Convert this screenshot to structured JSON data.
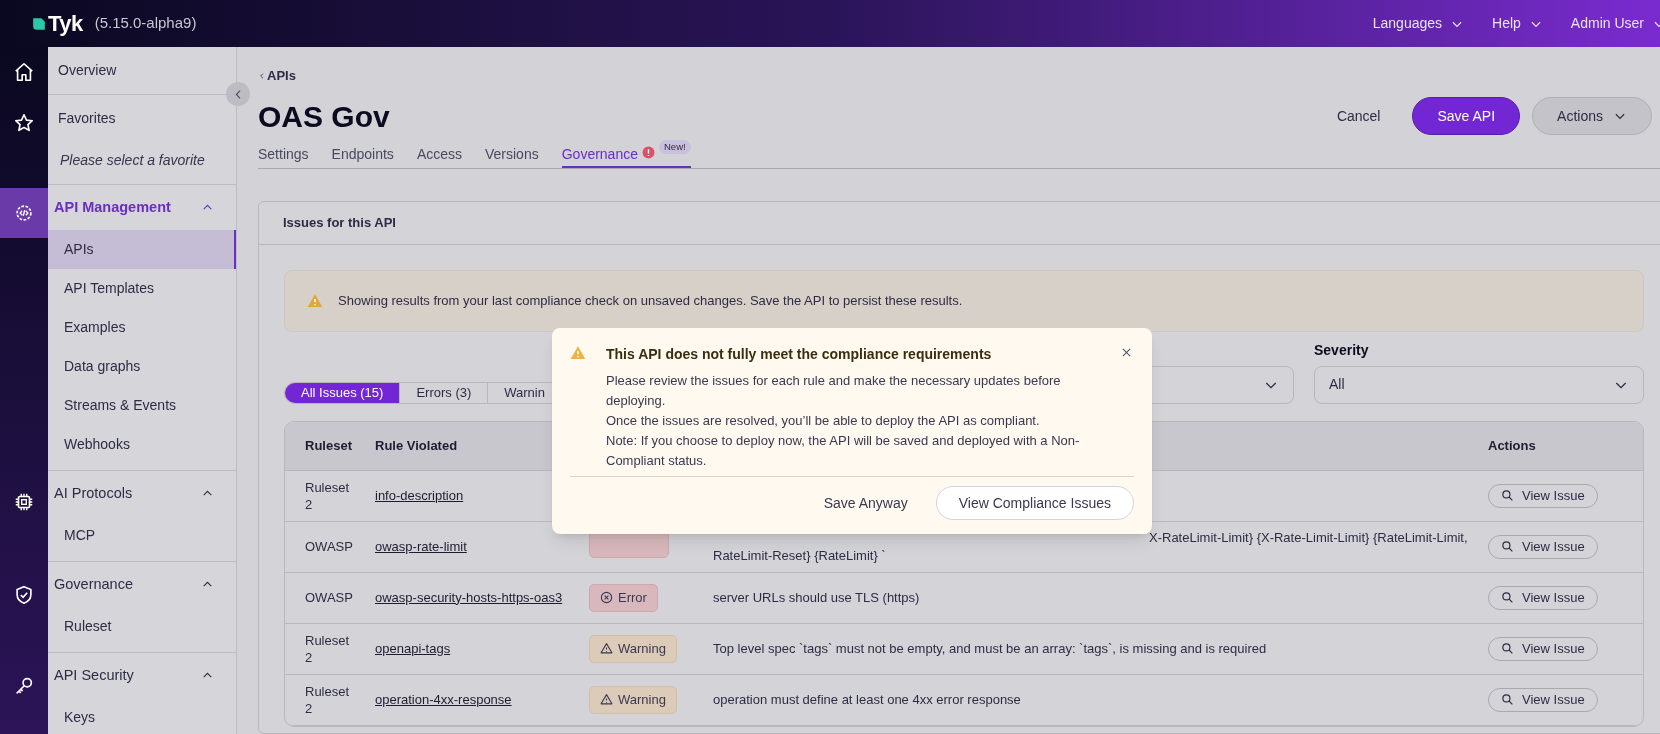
{
  "topbar": {
    "logo": "Tyk",
    "version": "(5.15.0-alpha9)",
    "menus": [
      "Languages",
      "Help",
      "Admin User"
    ]
  },
  "rail": [
    {
      "kind": "home",
      "selected": false
    },
    {
      "kind": "star",
      "selected": false
    },
    {
      "kind": "gear",
      "selected": true
    },
    {
      "kind": "chip",
      "selected": false
    },
    {
      "kind": "shield",
      "selected": false
    },
    {
      "kind": "key",
      "selected": false
    }
  ],
  "sidebar": [
    {
      "kind": "link",
      "label": "Overview"
    },
    {
      "kind": "link",
      "label": "Favorites",
      "note": "Please select a favorite"
    },
    {
      "kind": "group",
      "label": "API Management",
      "expanded": true,
      "selected": true,
      "children": [
        {
          "label": "APIs",
          "selected": true
        },
        {
          "label": "API Templates",
          "selected": false
        },
        {
          "label": "Examples",
          "selected": false
        },
        {
          "label": "Data graphs",
          "selected": false
        },
        {
          "label": "Streams & Events",
          "selected": false
        },
        {
          "label": "Webhooks",
          "selected": false
        }
      ]
    },
    {
      "kind": "group",
      "label": "AI Protocols",
      "expanded": true,
      "selected": false,
      "children": [
        {
          "label": "MCP",
          "selected": false
        }
      ]
    },
    {
      "kind": "group",
      "label": "Governance",
      "expanded": true,
      "selected": false,
      "children": [
        {
          "label": "Ruleset",
          "selected": false
        }
      ]
    },
    {
      "kind": "group",
      "label": "API Security",
      "expanded": true,
      "selected": false,
      "children": [
        {
          "label": "Keys",
          "selected": false
        }
      ]
    }
  ],
  "breadcrumb": "APIs",
  "title": "OAS Gov",
  "actions": {
    "cancel": "Cancel",
    "save": "Save API",
    "more": "Actions"
  },
  "tabs": [
    {
      "label": "Settings",
      "selected": false
    },
    {
      "label": "Endpoints",
      "selected": false
    },
    {
      "label": "Access",
      "selected": false
    },
    {
      "label": "Versions",
      "selected": false
    },
    {
      "label": "Governance",
      "selected": true,
      "alert": true,
      "badge": "New!"
    }
  ],
  "card": {
    "title": "Issues for this API",
    "notice": "Showing results from your last compliance check on unsaved changes. Save the API to persist these results.",
    "filter_tabs": [
      {
        "label": "All Issues (15)",
        "selected": true
      },
      {
        "label": "Errors (3)",
        "selected": false
      },
      {
        "label": "Warnin",
        "selected": false
      }
    ],
    "severity": {
      "label": "Severity",
      "value": "All"
    },
    "table": {
      "columns": [
        "Ruleset",
        "Rule Violated",
        "Actions"
      ],
      "rows": [
        {
          "ruleset": "Ruleset 2",
          "rule": "info-description",
          "action": "View Issue"
        },
        {
          "ruleset": "OWASP",
          "rule": "owasp-rate-limit",
          "severity": {
            "kind": "error"
          },
          "message": [
            "X-RateLimit-Limit} {X-Rate-Limit-Limit} {RateLimit-Limit,",
            "RateLimit-Reset} {RateLimit} `"
          ],
          "action": "View Issue"
        },
        {
          "ruleset": "OWASP",
          "rule": "owasp-security-hosts-https-oas3",
          "severity": {
            "kind": "error",
            "label": "Error"
          },
          "message": [
            "server URLs should use TLS (https)"
          ],
          "action": "View Issue"
        },
        {
          "ruleset": "Ruleset 2",
          "rule": "openapi-tags",
          "severity": {
            "kind": "warning",
            "label": "Warning"
          },
          "message": [
            "Top level spec `tags` must not be empty, and must be an array: `tags`, is missing and is required"
          ],
          "action": "View Issue"
        },
        {
          "ruleset": "Ruleset 2",
          "rule": "operation-4xx-response",
          "severity": {
            "kind": "warning",
            "label": "Warning"
          },
          "message": [
            "operation must define at least one 4xx error response"
          ],
          "action": "View Issue"
        }
      ]
    }
  },
  "dialog": {
    "title": "This API does not fully meet the compliance requirements",
    "body": [
      "Please review the issues for each rule and make the necessary updates before deploying.",
      "Once the issues are resolved, you’ll be able to deploy the API as compliant.",
      "Note: If you choose to deploy now, the API will be saved and deployed with a Non-Compliant status."
    ],
    "secondary": "Save Anyway",
    "primary": "View Compliance Issues"
  }
}
